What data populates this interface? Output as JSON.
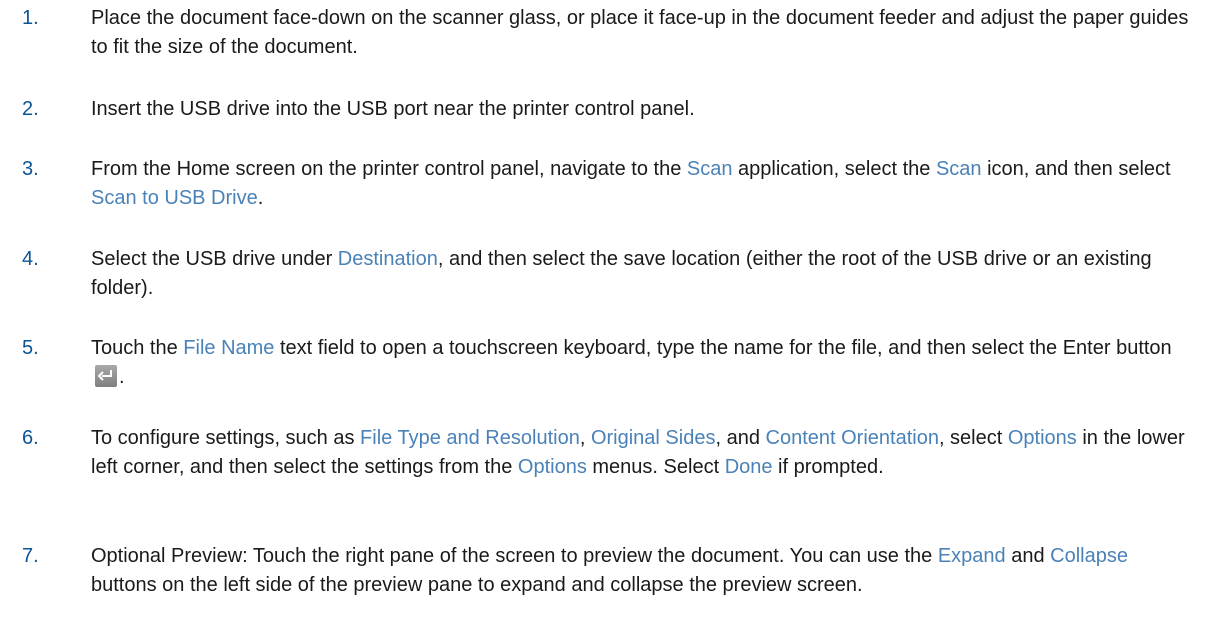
{
  "steps": [
    {
      "number": "1.",
      "segments": [
        {
          "text": "Place the document face-down on the scanner glass, or place it face-up in the document feeder and adjust the paper guides to fit the size of the document.",
          "hl": false
        }
      ]
    },
    {
      "number": "2.",
      "segments": [
        {
          "text": "Insert the USB drive into the USB port near the printer control panel.",
          "hl": false
        }
      ]
    },
    {
      "number": "3.",
      "segments": [
        {
          "text": "From the Home screen on the printer control panel, navigate to the ",
          "hl": false
        },
        {
          "text": "Scan",
          "hl": true
        },
        {
          "text": " application, select the ",
          "hl": false
        },
        {
          "text": "Scan",
          "hl": true
        },
        {
          "text": " icon, and then select ",
          "hl": false
        },
        {
          "text": "Scan to USB Drive",
          "hl": true
        },
        {
          "text": ".",
          "hl": false
        }
      ]
    },
    {
      "number": "4.",
      "segments": [
        {
          "text": "Select the USB drive under ",
          "hl": false
        },
        {
          "text": "Destination",
          "hl": true
        },
        {
          "text": ", and then select the save location (either the root of the USB drive or an existing folder).",
          "hl": false
        }
      ]
    },
    {
      "number": "5.",
      "segments": [
        {
          "text": "Touch the ",
          "hl": false
        },
        {
          "text": "File Name",
          "hl": true
        },
        {
          "text": " text field to open a touchscreen keyboard, type the name for the file, and then select the Enter button ",
          "hl": false
        },
        {
          "icon": "enter-key-icon"
        },
        {
          "text": ".",
          "hl": false
        }
      ]
    },
    {
      "number": "6.",
      "segments": [
        {
          "text": "To configure settings, such as ",
          "hl": false
        },
        {
          "text": "File Type and Resolution",
          "hl": true
        },
        {
          "text": ", ",
          "hl": false
        },
        {
          "text": "Original Sides",
          "hl": true
        },
        {
          "text": ", and ",
          "hl": false
        },
        {
          "text": "Content Orientation",
          "hl": true
        },
        {
          "text": ", select ",
          "hl": false
        },
        {
          "text": "Options",
          "hl": true
        },
        {
          "text": " in the lower left corner, and then select the settings from the ",
          "hl": false
        },
        {
          "text": "Options",
          "hl": true
        },
        {
          "text": " menus. Select ",
          "hl": false
        },
        {
          "text": "Done",
          "hl": true
        },
        {
          "text": " if prompted.",
          "hl": false
        }
      ]
    },
    {
      "number": "7.",
      "segments": [
        {
          "text": "Optional Preview: Touch the right pane of the screen to preview the document. You can use the ",
          "hl": false
        },
        {
          "text": "Expand",
          "hl": true
        },
        {
          "text": " and ",
          "hl": false
        },
        {
          "text": "Collapse",
          "hl": true
        },
        {
          "text": " buttons on the left side of the preview pane to expand and collapse the preview screen.",
          "hl": false
        }
      ]
    }
  ],
  "colors": {
    "number": "#0b5496",
    "body_text": "#1a1a1a",
    "highlight": "#4a82b8"
  }
}
